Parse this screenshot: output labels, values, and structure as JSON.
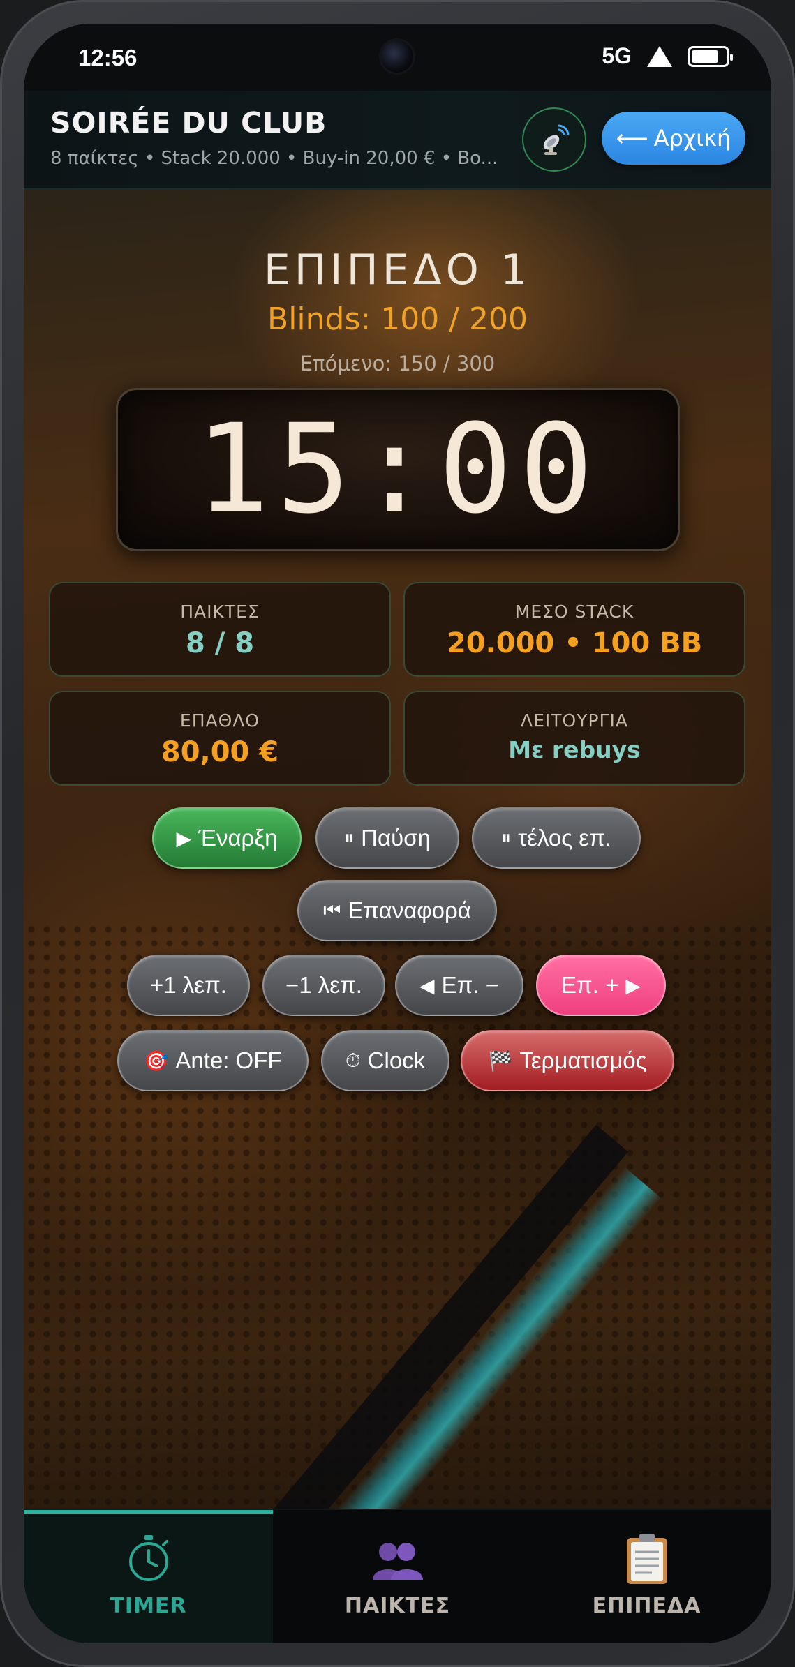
{
  "status_bar": {
    "time": "12:56",
    "network": "5G"
  },
  "header": {
    "title": "SOIRÉE DU CLUB",
    "subtitle": "8 παίκτες • Stack 20.000 • Buy-in 20,00 € • Bo...",
    "home_label": "Αρχική",
    "home_arrow": "⟵",
    "cast_icon": "satellite-dish-icon"
  },
  "timer": {
    "level": "ΕΠΙΠΕΔΟ 1",
    "blinds": "Blinds: 100 / 200",
    "next": "Επόμενο: 150 / 300",
    "clock": "15:00"
  },
  "stats": {
    "players": {
      "label": "ΠΑΙΚΤΕΣ",
      "value": "8 / 8"
    },
    "avg_stack": {
      "label": "ΜΕΣΟ STACK",
      "value": "20.000 • 100 BB"
    },
    "prize": {
      "label": "ΕΠΑΘΛΟ",
      "value": "80,00 €"
    },
    "mode": {
      "label": "ΛΕΙΤΟΥΡΓΙΑ",
      "value": "Με rebuys"
    }
  },
  "controls": {
    "start": {
      "icon": "▶",
      "label": "Έναρξη"
    },
    "pause": {
      "icon": "⏸",
      "label": "Παύση"
    },
    "end_level": {
      "icon": "⏸",
      "label": "τέλος επ."
    },
    "reset": {
      "icon": "⏮",
      "label": "Επαναφορά"
    },
    "plus_minute": "+1 λεπ.",
    "minus_minute": "−1 λεπ.",
    "prev_level": {
      "icon": "◀",
      "label": "Επ. −"
    },
    "next_level": {
      "icon": "▶",
      "label": "Επ. +"
    },
    "ante": {
      "icon": "🎯",
      "label": "Ante: OFF"
    },
    "clock": {
      "icon": "⏱",
      "label": "Clock"
    },
    "finish": {
      "icon": "🏁",
      "label": "Τερματισμός"
    }
  },
  "nav": {
    "tabs": [
      {
        "label": "TIMER",
        "icon": "stopwatch-icon",
        "active": true
      },
      {
        "label": "ΠΑΙΚΤΕΣ",
        "icon": "players-icon",
        "active": false
      },
      {
        "label": "ΕΠΙΠΕΔΑ",
        "icon": "clipboard-icon",
        "active": false
      }
    ]
  },
  "colors": {
    "accent_teal": "#2aa895",
    "accent_orange": "#f0a226",
    "home_blue": "#2b86e2",
    "start_green": "#247b34",
    "next_pink": "#f0407f",
    "finish_red": "#a31d22"
  }
}
